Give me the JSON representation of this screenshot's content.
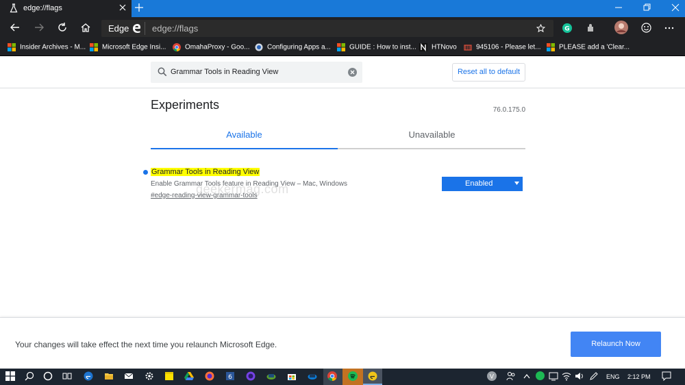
{
  "tab": {
    "title": "edge://flags",
    "favicon": "flask-icon"
  },
  "window": {
    "controls": [
      "minimize-icon",
      "restore-icon",
      "close-icon"
    ],
    "titlebar_color": "#1979d8"
  },
  "toolbar": {
    "brand": "Edge",
    "url": "edge://flags",
    "buttons": [
      "back-icon",
      "forward-icon",
      "refresh-icon",
      "home-icon",
      "favorite-star-icon",
      "grammarly-icon",
      "extension-icon",
      "profile-avatar",
      "feedback-smiley-icon",
      "more-menu-icon"
    ]
  },
  "bookmarks": [
    {
      "label": "Insider Archives - M...",
      "icon": "windows-logo-icon"
    },
    {
      "label": "Microsoft Edge Insi...",
      "icon": "windows-logo-icon"
    },
    {
      "label": "OmahaProxy - Goo...",
      "icon": "chrome-icon"
    },
    {
      "label": "Configuring Apps a...",
      "icon": "globe-icon"
    },
    {
      "label": "GUIDE : How to inst...",
      "icon": "windows-logo-icon"
    },
    {
      "label": "HTNovo",
      "icon": "htnovo-icon"
    },
    {
      "label": "945106 - Please let...",
      "icon": "bug-icon"
    },
    {
      "label": "PLEASE add a 'Clear...",
      "icon": "windows-logo-icon"
    }
  ],
  "header": {
    "search_value": "Grammar Tools in Reading View",
    "reset_label": "Reset all to default"
  },
  "main": {
    "title": "Experiments",
    "version": "76.0.175.0",
    "tabs": [
      {
        "label": "Available",
        "active": true
      },
      {
        "label": "Unavailable",
        "active": false
      }
    ],
    "flag": {
      "name": "Grammar Tools in Reading View",
      "description": "Enable Grammar Tools feature in Reading View – Mac, Windows",
      "link": "#edge-reading-view-grammar-tools",
      "selected": "Enabled",
      "watermark": "geekermag.com"
    }
  },
  "relaunch": {
    "message": "Your changes will take effect the next time you relaunch Microsoft Edge.",
    "button": "Relaunch Now"
  },
  "taskbar": {
    "apps": [
      "start-icon",
      "search-icon",
      "cortana-icon",
      "task-view-icon",
      "edge-icon",
      "file-explorer-icon",
      "mail-icon",
      "settings-icon",
      "sticky-notes-icon",
      "drive-icon",
      "firefox-icon",
      "calendar-icon",
      "firefox-nightly-icon",
      "app-icon",
      "store-icon",
      "app-icon",
      "chrome-icon",
      "spotify-icon",
      "edge-canary-icon"
    ],
    "calendar_badge": "6",
    "language": "ENG",
    "time": "2:12 PM"
  },
  "colors": {
    "accent": "#1a73e8",
    "relaunch_button": "#4285f4",
    "highlight": "#ffff00"
  }
}
